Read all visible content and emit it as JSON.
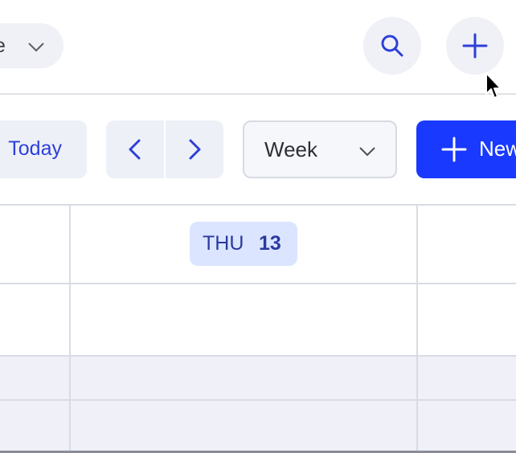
{
  "header": {
    "view_chip_label": "e",
    "search_icon": "search-icon",
    "add_icon": "plus-icon"
  },
  "toolbar": {
    "today_label": "Today",
    "prev_icon": "chevron-left-icon",
    "next_icon": "chevron-right-icon",
    "view_select_value": "Week",
    "new_label": "New"
  },
  "calendar": {
    "day_header": {
      "dow": "THU",
      "day_number": "13"
    }
  },
  "colors": {
    "accent": "#1939ff",
    "accent_text": "#2d3fd9",
    "pill_bg": "#dbe5ff",
    "chip_bg": "#f0f1f7",
    "grid_line": "#d8dbe3"
  }
}
